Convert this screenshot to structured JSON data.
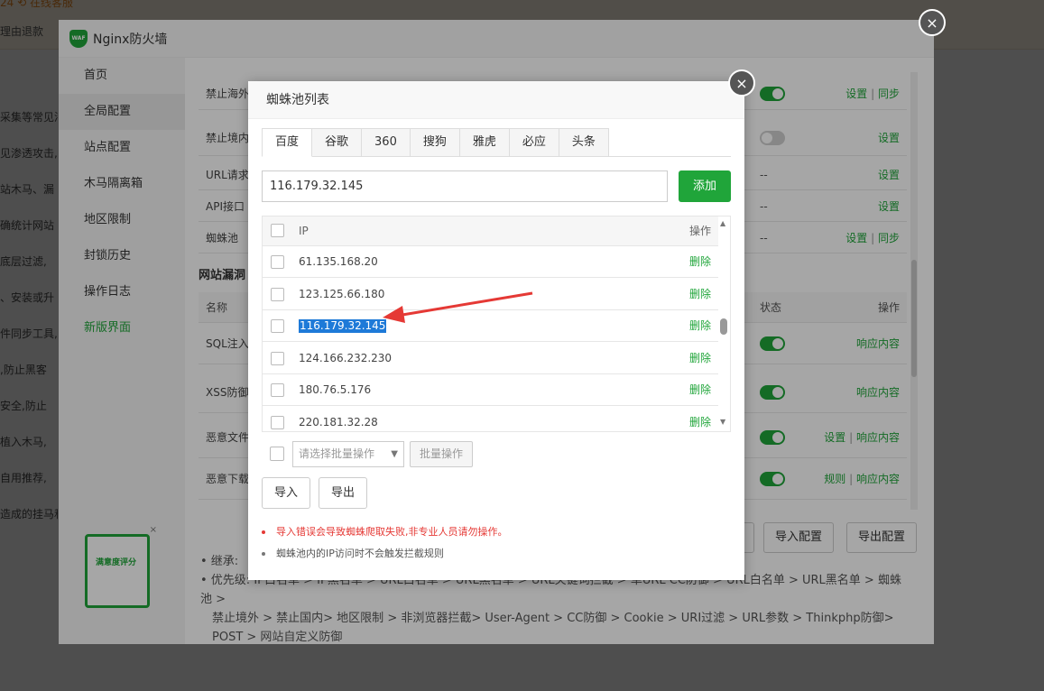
{
  "background": {
    "topbar_text_1": "24  ⟲ 在线客服",
    "topbar_text_2": "理由退款",
    "left_fragments": [
      "采集等常见渗透",
      "见渗透攻击,",
      "站木马、漏",
      "确统计网站",
      "底层过滤,",
      "、安装或升",
      "件同步工具,",
      ",防止黑客",
      "安全,防止",
      "植入木马,",
      "自用推荐,",
      "造成的挂马和"
    ]
  },
  "firewall": {
    "title": "Nginx防火墙",
    "waf_badge": "WAF",
    "close_glyph": "×",
    "sidebar": [
      {
        "label": "首页",
        "active": false
      },
      {
        "label": "全局配置",
        "active": true
      },
      {
        "label": "站点配置",
        "active": false
      },
      {
        "label": "木马隔离箱",
        "active": false
      },
      {
        "label": "地区限制",
        "active": false
      },
      {
        "label": "封锁历史",
        "active": false
      },
      {
        "label": "操作日志",
        "active": false
      },
      {
        "label": "新版界面",
        "active": false
      }
    ],
    "rows_top": [
      {
        "label": "禁止海外",
        "state": "on",
        "action": "设置",
        "action2": "同步"
      },
      {
        "label": "禁止境内",
        "state": "off",
        "action": "设置",
        "action2": ""
      },
      {
        "label": "URL请求",
        "state": "--",
        "action": "设置",
        "action2": ""
      },
      {
        "label": "API接口",
        "state": "--",
        "action": "设置",
        "action2": ""
      },
      {
        "label": "蜘蛛池",
        "state": "--",
        "action": "设置",
        "action2": "同步"
      }
    ],
    "section_title": "网站漏洞",
    "table_head": {
      "name": "名称",
      "status": "状态",
      "op": "操作"
    },
    "rows_bottom": [
      {
        "label": "SQL注入",
        "action": "响应内容",
        "action0": ""
      },
      {
        "label": "XSS防御",
        "action": "响应内容",
        "action0": ""
      },
      {
        "label": "恶意文件",
        "action": "响应内容",
        "action0": "设置"
      },
      {
        "label": "恶意下载",
        "action": "响应内容",
        "action0": "规则"
      }
    ],
    "buttons": {
      "import_config": "导入配置",
      "export_config": "导出配置"
    },
    "notes": {
      "inherit": "• 继承:",
      "priority": "• 优先级: IP白名单 > IP黑名单 > URL白名单 > URL黑名单 > URL关键词拦截 > 单URL CC防御 > URL白名单 > URL黑名单 > 蜘蛛池 >",
      "priority_line2": "禁止境外 > 禁止国内> 地区限制 > 非浏览器拦截> User-Agent > CC防御 > Cookie > URI过滤 > URL参数 > Thinkphp防御>",
      "priority_line3": "POST > 网站自定义防御"
    },
    "rating_label": "满意度评分",
    "rating_close": "×"
  },
  "dialog": {
    "title": "蜘蛛池列表",
    "close_glyph": "×",
    "tabs": [
      {
        "label": "百度",
        "active": true
      },
      {
        "label": "谷歌",
        "active": false
      },
      {
        "label": "360",
        "active": false
      },
      {
        "label": "搜狗",
        "active": false
      },
      {
        "label": "雅虎",
        "active": false
      },
      {
        "label": "必应",
        "active": false
      },
      {
        "label": "头条",
        "active": false
      }
    ],
    "input_value": "116.179.32.145",
    "add_label": "添加",
    "table_head": {
      "ip": "IP",
      "op": "操作"
    },
    "rows": [
      {
        "ip": "61.135.168.20",
        "action": "删除",
        "selected": false
      },
      {
        "ip": "123.125.66.180",
        "action": "删除",
        "selected": false
      },
      {
        "ip": "116.179.32.145",
        "action": "删除",
        "selected": true
      },
      {
        "ip": "124.166.232.230",
        "action": "删除",
        "selected": false
      },
      {
        "ip": "180.76.5.176",
        "action": "删除",
        "selected": false
      },
      {
        "ip": "220.181.32.28",
        "action": "删除",
        "selected": false
      }
    ],
    "batch_placeholder": "请选择批量操作",
    "batch_button": "批量操作",
    "import_label": "导入",
    "export_label": "导出",
    "warning_red": "导入错误会导致蜘蛛爬取失败,非专业人员请勿操作。",
    "warning_gray": "蜘蛛池内的IP访问时不会触发拦截规则"
  },
  "colors": {
    "accent": "#20a53a",
    "annotation_arrow": "#e53935",
    "selection": "#1e7ad8"
  }
}
